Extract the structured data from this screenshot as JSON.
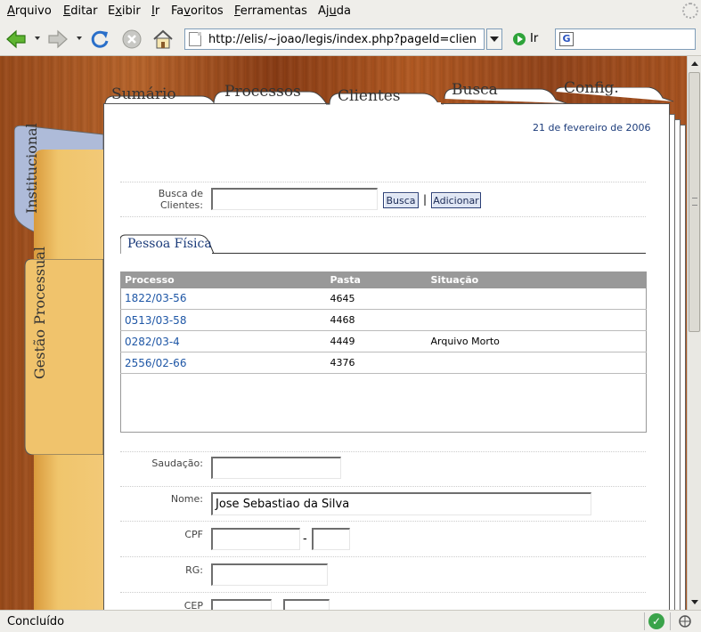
{
  "menu": {
    "items": [
      {
        "ul": "A",
        "rest": "rquivo"
      },
      {
        "ul": "E",
        "rest": "ditar"
      },
      {
        "ul": "E",
        "rest": "xibir",
        "pre": ""
      },
      {
        "ul": "I",
        "rest": "r"
      },
      {
        "ul": "F",
        "rest": "avoritos"
      },
      {
        "ul": "F",
        "rest": "erramentas"
      },
      {
        "ul": "A",
        "rest": "juda"
      }
    ],
    "m0a": "A",
    "m0b": "rquivo",
    "m1a": "E",
    "m1b": "ditar",
    "m2a": "E",
    "m2b": "x",
    "m2c": "i",
    "m2d": "bir",
    "m3a": "I",
    "m3b": "r",
    "m4a": "Fa",
    "m4b": "v",
    "m4c": "oritos",
    "m5a": "F",
    "m5b": "erramentas",
    "m6a": "Aj",
    "m6b": "u",
    "m6c": "da"
  },
  "toolbar": {
    "url": "http://elis/~joao/legis/index.php?pageId=clientFo",
    "go_label": "Ir"
  },
  "tabs": {
    "sumario": "Sumário",
    "processos": "Processos",
    "clientes": "Clientes",
    "busca": "Busca",
    "config": "Config."
  },
  "side_tabs": {
    "institucional": "Institucional",
    "gestao": "Gestão Processual"
  },
  "date": "21 de fevereiro de 2006",
  "search": {
    "label_line1": "Busca de",
    "label_line2": "Clientes:",
    "value": "",
    "busca_button": "Busca",
    "separator": "|",
    "adicionar_button": "Adicionar"
  },
  "section_title": "Pessoa Física",
  "table": {
    "headers": [
      "Processo",
      "Pasta",
      "Situação"
    ],
    "rows": [
      {
        "processo": "1822/03-56",
        "pasta": "4645",
        "situacao": ""
      },
      {
        "processo": "0513/03-58",
        "pasta": "4468",
        "situacao": ""
      },
      {
        "processo": "0282/03-4",
        "pasta": "4449",
        "situacao": "Arquivo Morto"
      },
      {
        "processo": "2556/02-66",
        "pasta": "4376",
        "situacao": ""
      }
    ]
  },
  "form": {
    "saudacao_label": "Saudação:",
    "saudacao_value": "",
    "nome_label": "Nome:",
    "nome_value": "Jose Sebastiao da Silva",
    "cpf_label": "CPF",
    "cpf_part1": "",
    "cpf_dash": "-",
    "cpf_part2": "",
    "rg_label": "RG:",
    "rg_value": "",
    "cep_label": "CEP",
    "cep_part1": "",
    "cep_part2": ""
  },
  "status": {
    "text": "Concluído"
  }
}
